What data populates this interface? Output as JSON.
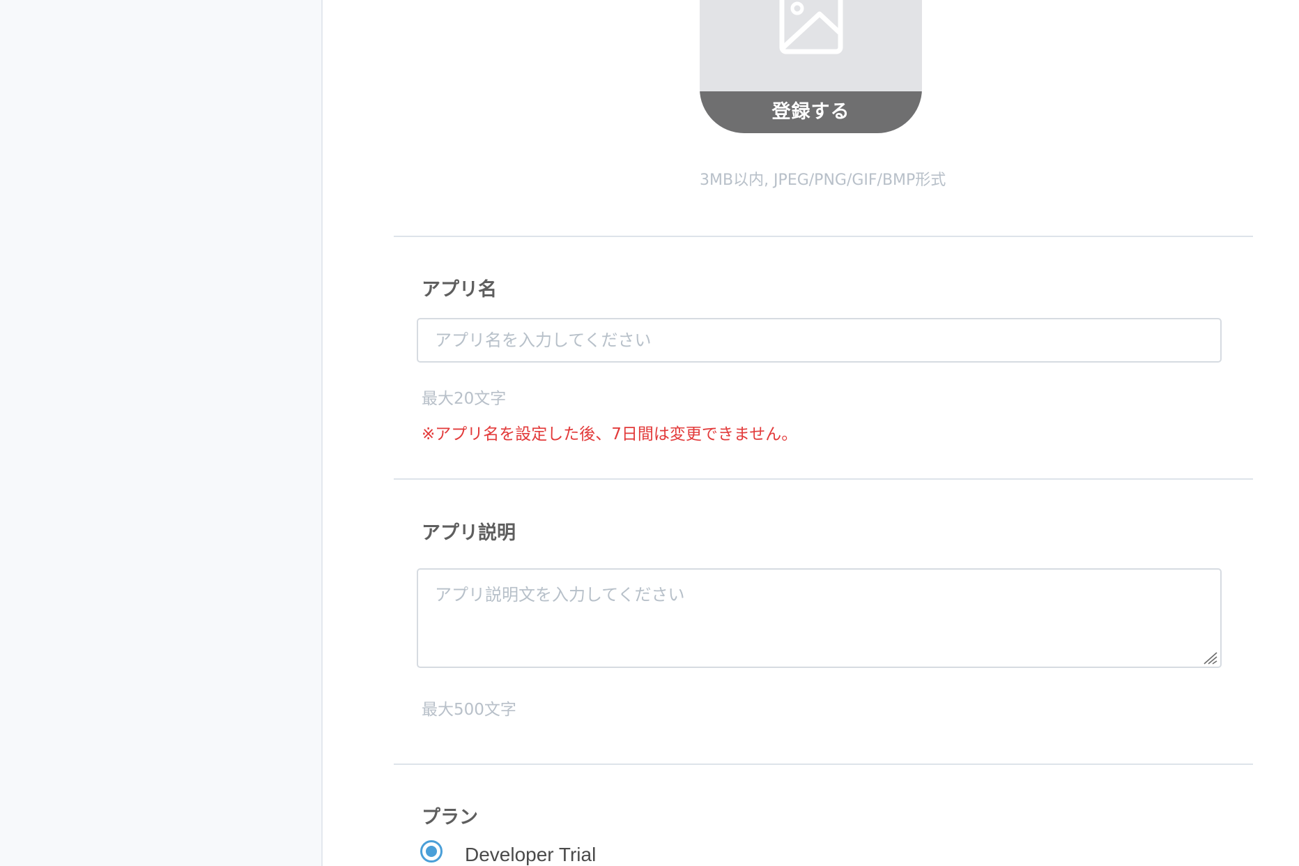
{
  "uploader": {
    "icon": "image-placeholder-icon",
    "register_label": "登録する",
    "hint": "3MB以内, JPEG/PNG/GIF/BMP形式"
  },
  "app_name": {
    "title": "アプリ名",
    "placeholder": "アプリ名を入力してください",
    "value": "",
    "hint": "最大20文字",
    "warning": "※アプリ名を設定した後、7日間は変更できません。"
  },
  "app_description": {
    "title": "アプリ説明",
    "placeholder": "アプリ説明文を入力してください",
    "value": "",
    "hint": "最大500文字"
  },
  "plan": {
    "title": "プラン",
    "options": [
      {
        "label": "Developer Trial",
        "selected": true
      }
    ]
  },
  "colors": {
    "accent": "#4a9fd8",
    "warning": "#e23a3a",
    "muted": "#b8c0c9"
  }
}
